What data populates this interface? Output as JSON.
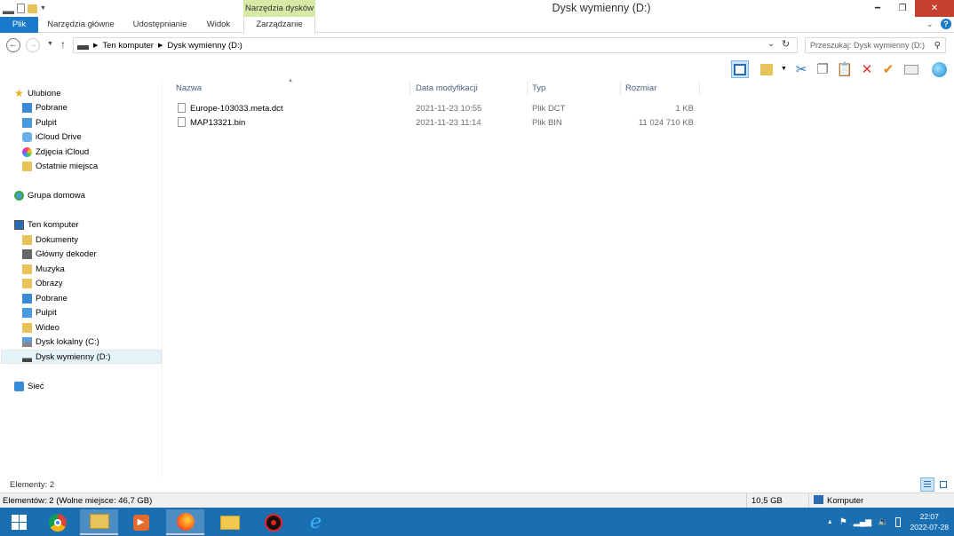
{
  "window": {
    "title": "Dysk wymienny (D:)",
    "context_tab_group": "Narzędzia dysków",
    "icons": {
      "minimize": "minimize-icon",
      "maximize": "maximize-icon",
      "close": "close-icon"
    }
  },
  "ribbon": {
    "tabs": [
      "Plik",
      "Narzędzia główne",
      "Udostępnianie",
      "Widok",
      "Zarządzanie"
    ],
    "accent": "#1979ca"
  },
  "address": {
    "crumbs": [
      "Ten komputer",
      "Dysk wymienny (D:)"
    ],
    "search_placeholder": "Przeszukaj: Dysk wymienny (D:)"
  },
  "nav": {
    "favorites": {
      "label": "Ulubione",
      "items": [
        "Pobrane",
        "Pulpit",
        "iCloud Drive",
        "Zdjęcia iCloud",
        "Ostatnie miejsca"
      ]
    },
    "homegroup": "Grupa domowa",
    "computer": {
      "label": "Ten komputer",
      "items": [
        "Dokumenty",
        "Główny dekoder",
        "Muzyka",
        "Obrazy",
        "Pobrane",
        "Pulpit",
        "Wideo",
        "Dysk lokalny (C:)",
        "Dysk wymienny (D:)"
      ]
    },
    "network": "Sieć",
    "selected": "Dysk wymienny (D:)"
  },
  "columns": {
    "name": "Nazwa",
    "date": "Data modyfikacji",
    "type": "Typ",
    "size": "Rozmiar"
  },
  "files": [
    {
      "name": "Europe-103033.meta.dct",
      "date": "2021-11-23 10:55",
      "type": "Plik DCT",
      "size": "1 KB"
    },
    {
      "name": "MAP13321.bin",
      "date": "2021-11-23 11:14",
      "type": "Plik BIN",
      "size": "11 024 710 KB"
    }
  ],
  "status": {
    "items_count": "Elementy: 2",
    "details": "Elementów: 2 (Wolne miejsce: 46,7 GB)",
    "size": "10,5 GB",
    "location": "Komputer"
  },
  "taskbar": {
    "apps": [
      "start-icon",
      "chrome-icon",
      "explorer-icon",
      "media-player-icon",
      "firefox-icon",
      "mail-icon",
      "music-icon",
      "ie-icon"
    ],
    "time": "22:07",
    "date": "2022-07-28"
  }
}
